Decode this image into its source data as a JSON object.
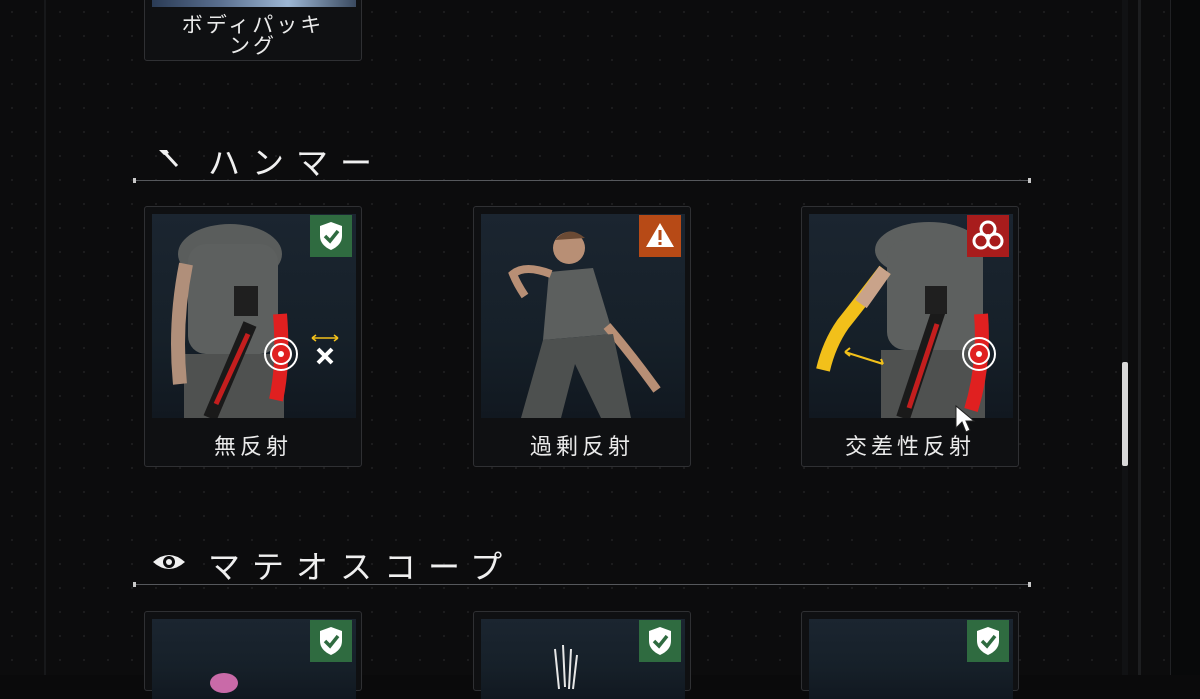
{
  "top_card": {
    "label_line1": "ボディパッキ",
    "label_line2": "ング"
  },
  "sections": [
    {
      "title": "ハンマー",
      "icon": "hammer-icon",
      "cards": [
        {
          "label": "無反射",
          "badge": "shield-check-icon",
          "badge_color": "#2f6b40"
        },
        {
          "label": "過剰反射",
          "badge": "warning-icon",
          "badge_color": "#b74a16"
        },
        {
          "label": "交差性反射",
          "badge": "biohazard-icon",
          "badge_color": "#a81c1c"
        }
      ]
    },
    {
      "title": "マテオスコープ",
      "icon": "eye-icon",
      "cards": [
        {
          "badge": "shield-check-icon",
          "badge_color": "#2f6b40"
        },
        {
          "badge": "shield-check-icon",
          "badge_color": "#2f6b40"
        },
        {
          "badge": "shield-check-icon",
          "badge_color": "#2f6b40"
        }
      ]
    }
  ],
  "colors": {
    "limb_red": "#e02020",
    "limb_yellow": "#f2c01a",
    "panel_bg": "#0c0c0d"
  }
}
